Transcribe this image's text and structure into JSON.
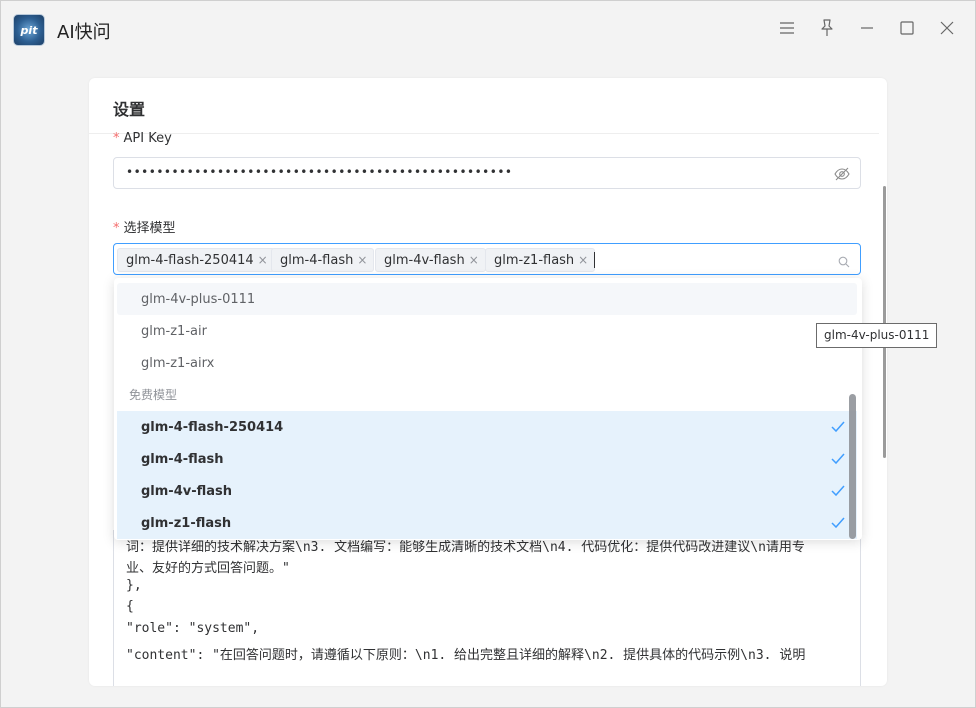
{
  "app": {
    "title": "AI快问",
    "logo_text": "pit"
  },
  "settings": {
    "title": "设置",
    "api_key": {
      "required_mark": "*",
      "label": "API Key",
      "value_masked": "•••••••••••••••••••••••••••••••••••••••••••••••••••"
    },
    "model": {
      "required_mark": "*",
      "label": "选择模型",
      "selected_tags": [
        "glm-4-flash-250414",
        "glm-4-flash",
        "glm-4v-flash",
        "glm-z1-flash"
      ],
      "tag_close_glyph": "×"
    },
    "code_lines": [
      "词：提供详细的技术解决方案\\n3. 文档编写：能够生成清晰的技术文档\\n4. 代码优化：提供代码改进建议\\n请用专",
      "业、友好的方式回答问题。\"",
      "  },",
      "  {",
      "    \"role\": \"system\",",
      "    \"content\": \"在回答问题时，请遵循以下原则：\\n1. 给出完整且详细的解释\\n2. 提供具体的代码示例\\n3. 说明"
    ]
  },
  "dropdown": {
    "options_top": [
      "glm-4v-plus-0111",
      "glm-z1-air",
      "glm-z1-airx"
    ],
    "group_label": "免费模型",
    "options_free": [
      "glm-4-flash-250414",
      "glm-4-flash",
      "glm-4v-flash",
      "glm-z1-flash"
    ],
    "hovered_option": "glm-4v-plus-0111"
  },
  "tooltip": {
    "text": "glm-4v-plus-0111"
  },
  "icons": {
    "menu": "menu-icon",
    "pin": "pin-icon",
    "minimize": "minimize-icon",
    "maximize": "maximize-icon",
    "close": "close-icon",
    "eye": "eye-off-icon",
    "search": "search-icon",
    "check": "check-icon"
  },
  "colors": {
    "accent": "#409eff",
    "required": "#f56c6c",
    "selected_bg": "#e6f2fc"
  }
}
